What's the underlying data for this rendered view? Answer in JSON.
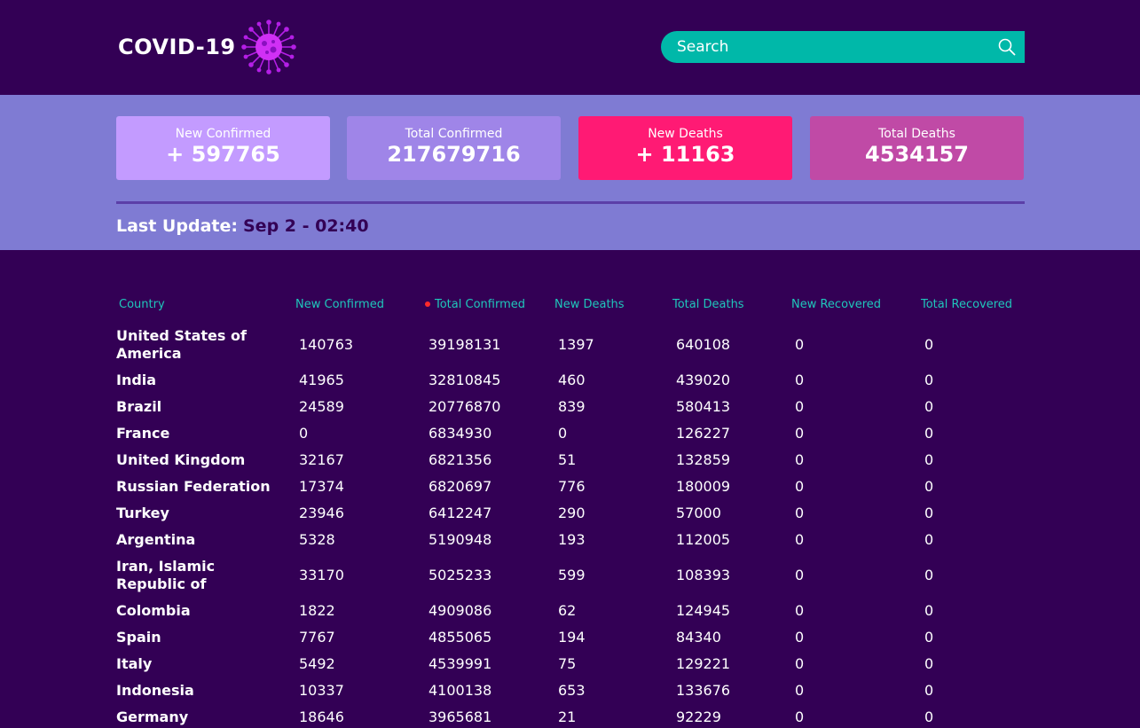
{
  "header": {
    "logo_text": "COVID-19",
    "search": {
      "placeholder": "Search"
    }
  },
  "stats": {
    "cards": [
      {
        "label": "New Confirmed",
        "value": "+ 597765"
      },
      {
        "label": "Total Confirmed",
        "value": "217679716"
      },
      {
        "label": "New Deaths",
        "value": "+ 11163"
      },
      {
        "label": "Total Deaths",
        "value": "4534157"
      }
    ],
    "last_update_label": "Last Update:",
    "last_update_value": "Sep 2 - 02:40"
  },
  "colors": {
    "background": "#330055",
    "band": "#7f7bd3",
    "accent": "#00b8a9",
    "new_confirmed": "#c39bff",
    "total_confirmed": "#9f85e8",
    "new_deaths": "#ff1a74",
    "total_deaths": "#c04aa6",
    "sort_indicator": "#ff2a2a"
  },
  "table": {
    "columns": [
      "Country",
      "New Confirmed",
      "Total Confirmed",
      "New Deaths",
      "Total Deaths",
      "New Recovered",
      "Total Recovered"
    ],
    "rows": [
      [
        "United States of America",
        "140763",
        "39198131",
        "1397",
        "640108",
        "0",
        "0"
      ],
      [
        "India",
        "41965",
        "32810845",
        "460",
        "439020",
        "0",
        "0"
      ],
      [
        "Brazil",
        "24589",
        "20776870",
        "839",
        "580413",
        "0",
        "0"
      ],
      [
        "France",
        "0",
        "6834930",
        "0",
        "126227",
        "0",
        "0"
      ],
      [
        "United Kingdom",
        "32167",
        "6821356",
        "51",
        "132859",
        "0",
        "0"
      ],
      [
        "Russian Federation",
        "17374",
        "6820697",
        "776",
        "180009",
        "0",
        "0"
      ],
      [
        "Turkey",
        "23946",
        "6412247",
        "290",
        "57000",
        "0",
        "0"
      ],
      [
        "Argentina",
        "5328",
        "5190948",
        "193",
        "112005",
        "0",
        "0"
      ],
      [
        "Iran, Islamic Republic of",
        "33170",
        "5025233",
        "599",
        "108393",
        "0",
        "0"
      ],
      [
        "Colombia",
        "1822",
        "4909086",
        "62",
        "124945",
        "0",
        "0"
      ],
      [
        "Spain",
        "7767",
        "4855065",
        "194",
        "84340",
        "0",
        "0"
      ],
      [
        "Italy",
        "5492",
        "4539991",
        "75",
        "129221",
        "0",
        "0"
      ],
      [
        "Indonesia",
        "10337",
        "4100138",
        "653",
        "133676",
        "0",
        "0"
      ],
      [
        "Germany",
        "18646",
        "3965681",
        "21",
        "92229",
        "0",
        "0"
      ]
    ]
  }
}
